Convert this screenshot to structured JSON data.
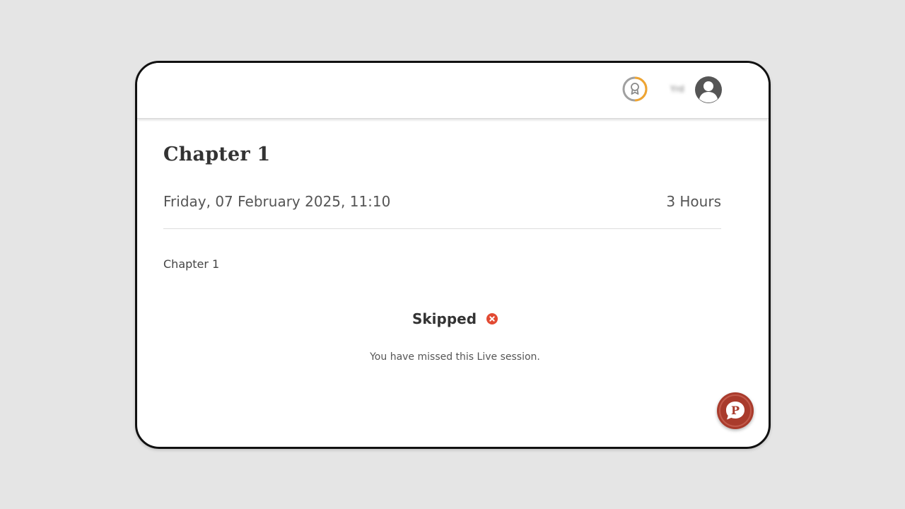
{
  "header": {
    "user_name": "Yrd",
    "badge_icon": "award-progress-icon",
    "avatar_icon": "user-avatar-icon",
    "badge_ring_color": "#f0a531"
  },
  "session": {
    "title": "Chapter 1",
    "datetime": "Friday, 07 February 2025, 11:10",
    "duration": "3 Hours",
    "description": "Chapter 1",
    "status": "Skipped",
    "status_icon": "close-circle-icon",
    "status_color": "#e24a33",
    "message": "You have missed this Live session."
  },
  "chat_button": {
    "icon": "chat-p-icon",
    "color": "#a93b2c"
  }
}
